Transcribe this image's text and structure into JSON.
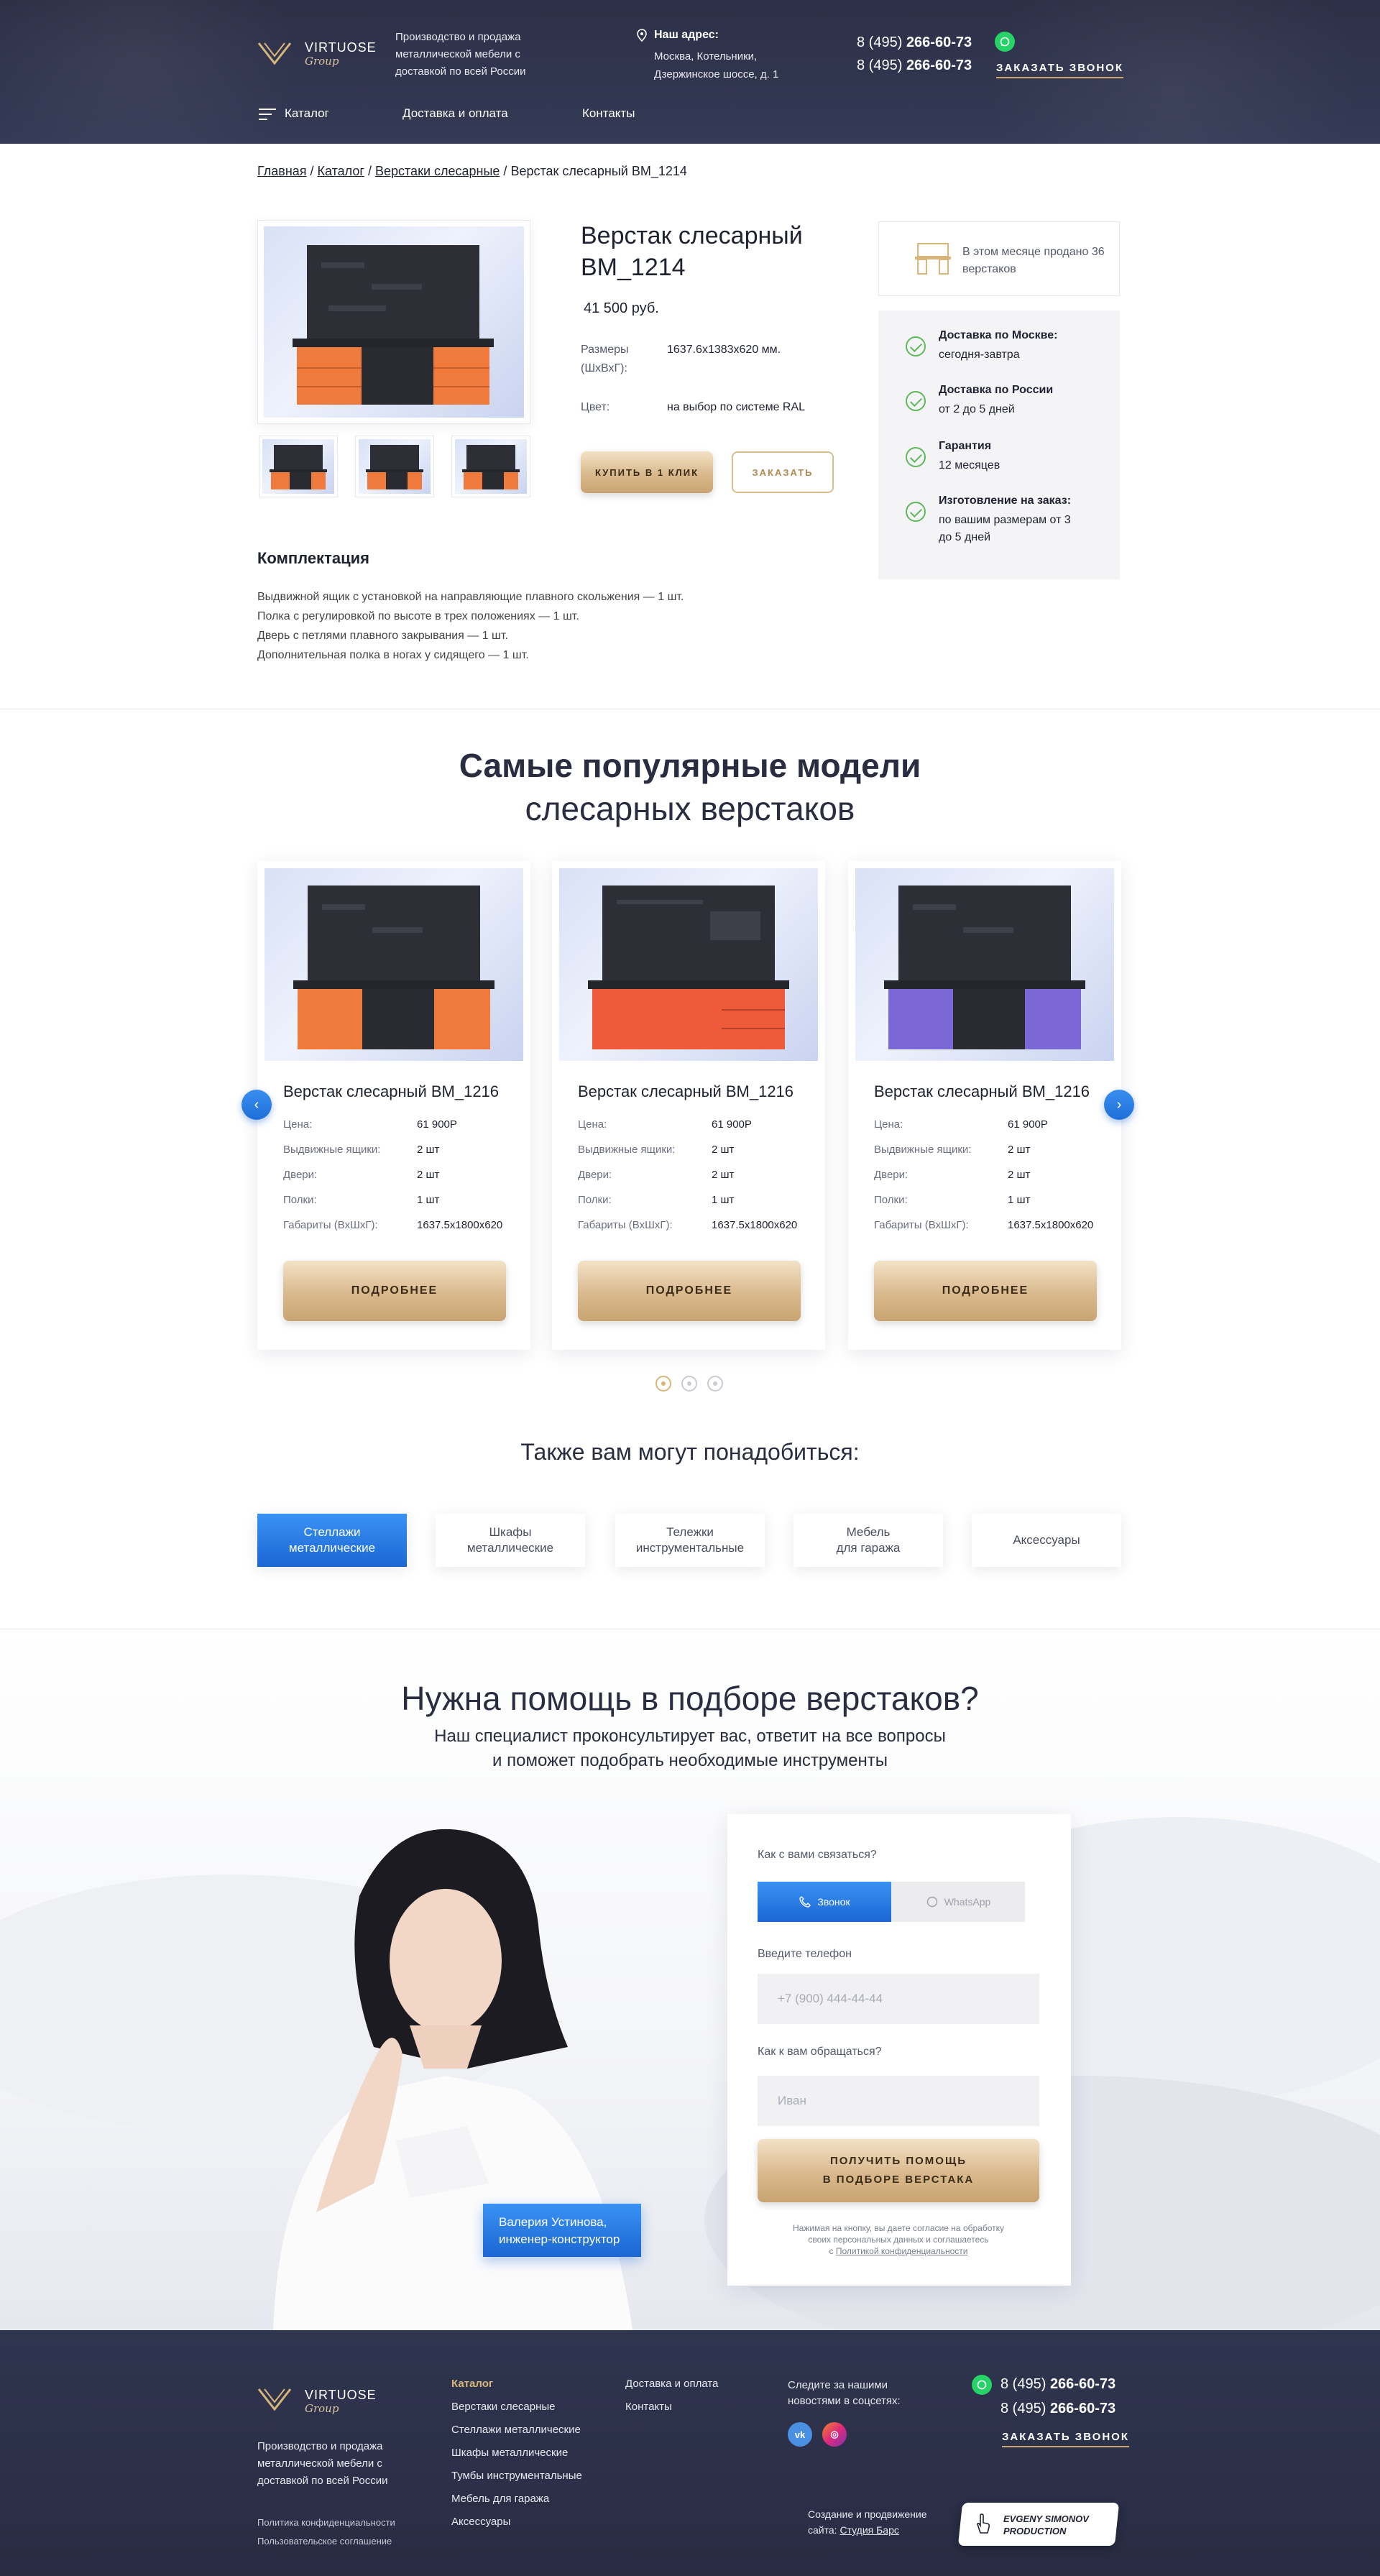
{
  "header": {
    "logo_name": "VIRTUOSE",
    "logo_sub": "Group",
    "description": "Производство и продажа металлической мебели с доставкой по всей России",
    "address_title": "Наш адрес:",
    "address_line1": "Москва, Котельники,",
    "address_line2": "Дзержинское шоссе, д. 1",
    "phone1_prefix": "8 (495)",
    "phone1_main": "266-60-73",
    "phone2_prefix": "8 (495)",
    "phone2_main": "266-60-73",
    "callback_label": "ЗАКАЗАТЬ ЗВОНОК",
    "nav": [
      "Каталог",
      "Доставка и оплата",
      "Контакты"
    ]
  },
  "breadcrumbs": [
    "Главная",
    "Каталог",
    "Верстаки слесарные",
    "Верстак слесарный ВМ_1214"
  ],
  "product": {
    "title": "Верстак слесарный ВМ_1214",
    "price": "41 500 руб.",
    "size_label": "Размеры (ШхВхГ):",
    "size_value": "1637.6х1383х620 мм.",
    "color_label": "Цвет:",
    "color_value": "на выбор по системе RAL",
    "buy_one_click": "КУПИТЬ В 1 КЛИК",
    "order": "ЗАКАЗАТЬ",
    "sold_text": "В этом месяце продано 36 верстаков",
    "benefits": [
      {
        "title": "Доставка по Москве:",
        "value": "сегодня-завтра"
      },
      {
        "title": "Доставка по России",
        "value": "от 2 до 5 дней"
      },
      {
        "title": "Гарантия",
        "value": "12 месяцев"
      },
      {
        "title": "Изготовление на заказ:",
        "value": "по вашим размерам от 3 до 5 дней"
      }
    ],
    "kit_title": "Комплектация",
    "kit_items": [
      "Выдвижной ящик с установкой на направляющие плавного скольжения — 1 шт.",
      "Полка с регулировкой по высоте в трех положениях — 1 шт.",
      "Дверь с петлями плавного закрывания  — 1 шт.",
      "Дополнительная полка в ногах у сидящего — 1 шт."
    ]
  },
  "popular": {
    "title_bold": "Самые популярные модели",
    "title_light": "слесарных верстаков",
    "more_label": "ПОДРОБНЕЕ",
    "spec_labels": [
      "Цена:",
      "Выдвижные ящики:",
      "Двери:",
      "Полки:",
      "Габариты (ВхШхГ):"
    ],
    "cards": [
      {
        "title": "Верстак слесарный ВМ_1216",
        "values": [
          "61 900Р",
          "2 шт",
          "2 шт",
          "1 шт",
          "1637.5х1800х620"
        ],
        "accent": "#f07a3c"
      },
      {
        "title": "Верстак слесарный ВМ_1216",
        "values": [
          "61 900Р",
          "2 шт",
          "2 шт",
          "1 шт",
          "1637.5х1800х620"
        ],
        "accent": "#ee5a3a"
      },
      {
        "title": "Верстак слесарный ВМ_1216",
        "values": [
          "61 900Р",
          "2 шт",
          "2 шт",
          "1 шт",
          "1637.5х1800х620"
        ],
        "accent": "#7b68d6"
      }
    ]
  },
  "also": {
    "title": "Также вам могут понадобиться:",
    "items": [
      "Стеллажи\nметаллические",
      "Шкафы\nметаллические",
      "Тележки\nинструментальные",
      "Мебель\nдля гаража",
      "Аксессуары"
    ]
  },
  "help": {
    "title": "Нужна помощь в подборе верстаков?",
    "sub1": "Наш специалист проконсультирует вас, ответит на все вопросы",
    "sub2": "и поможет подобрать необходимые инструменты",
    "how_contact": "Как с вами связаться?",
    "tab_call": "Звонок",
    "tab_whatsapp": "WhatsApp",
    "phone_label": "Введите телефон",
    "phone_placeholder": "+7 (900) 444-44-44",
    "name_label": "Как к вам обращаться?",
    "name_placeholder": "Иван",
    "submit1": "ПОЛУЧИТЬ ПОМОЩЬ",
    "submit2": "В ПОДБОРЕ ВЕРСТАКА",
    "note1": "Нажимая на кнопку, вы даете согласие на обработку",
    "note2": "своих персональных данных и соглашаетесь",
    "note3": "с",
    "note_link": "Политикой конфиденциальности",
    "specialist_name": "Валерия Устинова,",
    "specialist_role": "инженер-конструктор"
  },
  "footer": {
    "logo_name": "VIRTUOSE",
    "logo_sub": "Group",
    "description": "Производство и продажа металлической мебели с доставкой по всей России",
    "privacy": "Политика конфиденциальности",
    "agreement": "Пользовательское соглашение",
    "catalog_title": "Каталог",
    "catalog_items": [
      "Верстаки слесарные",
      "Стеллажи металлические",
      "Шкафы металлические",
      "Тумбы инструментальные",
      "Мебель для гаража",
      "Аксессуары"
    ],
    "links": [
      "Доставка и оплата",
      "Контакты"
    ],
    "social_text": "Следите за нашими новостями в соцсетях:",
    "phone1_prefix": "8 (495)",
    "phone1_main": "266-60-73",
    "phone2_prefix": "8 (495)",
    "phone2_main": "266-60-73",
    "callback_label": "ЗАКАЗАТЬ ЗВОНОК",
    "created_text": "Создание и продвижение",
    "created_site": "сайта:",
    "studio": "Студия  Барс",
    "es_line1": "EVGENY SIMONOV",
    "es_line2": "PRODUCTION"
  }
}
